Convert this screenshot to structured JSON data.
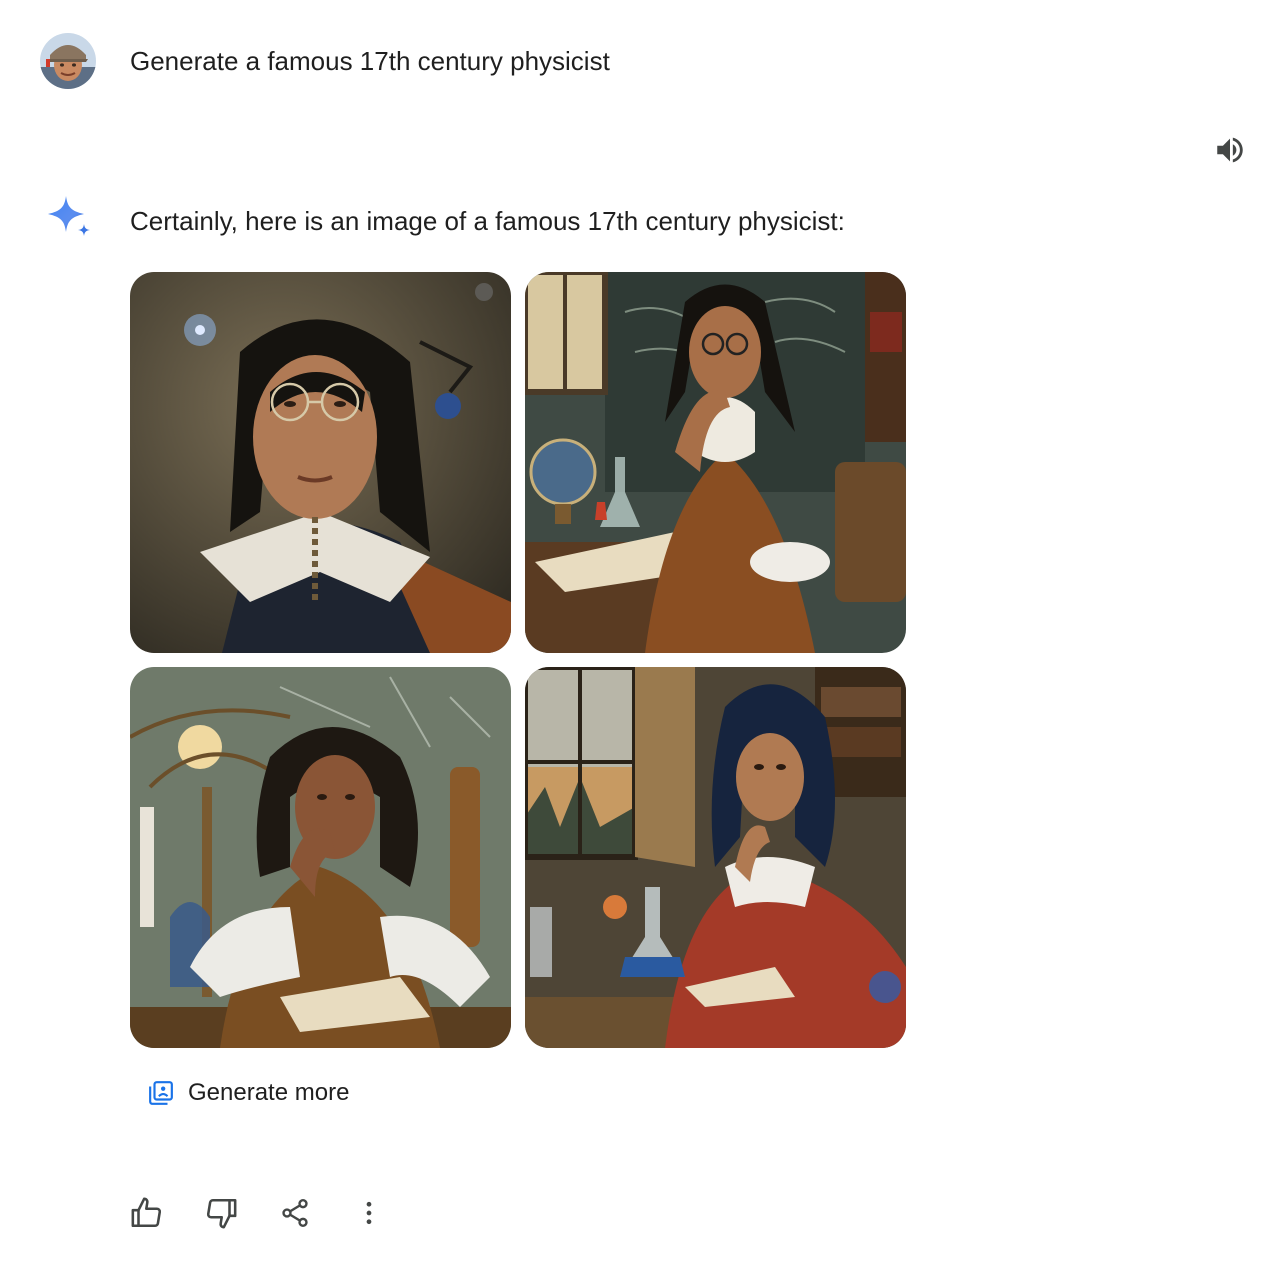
{
  "user_turn": {
    "avatar_icon": "user-avatar",
    "prompt": "Generate a famous 17th century physicist"
  },
  "speaker_icon": "volume-icon",
  "model_turn": {
    "spark_icon": "gemini-spark-icon",
    "spark_colors": [
      "#4285f4",
      "#5b8def",
      "#3b76e4"
    ],
    "response": "Certainly, here is an image of a famous 17th century physicist:"
  },
  "images": [
    {
      "icon": "generated-image-1"
    },
    {
      "icon": "generated-image-2"
    },
    {
      "icon": "generated-image-3"
    },
    {
      "icon": "generated-image-4"
    }
  ],
  "generate_more": {
    "icon": "image-stack-icon",
    "label": "Generate more",
    "accent": "#1a73e8"
  },
  "actions": [
    {
      "icon": "thumbs-up-icon"
    },
    {
      "icon": "thumbs-down-icon"
    },
    {
      "icon": "share-icon"
    },
    {
      "icon": "more-vert-icon"
    }
  ]
}
